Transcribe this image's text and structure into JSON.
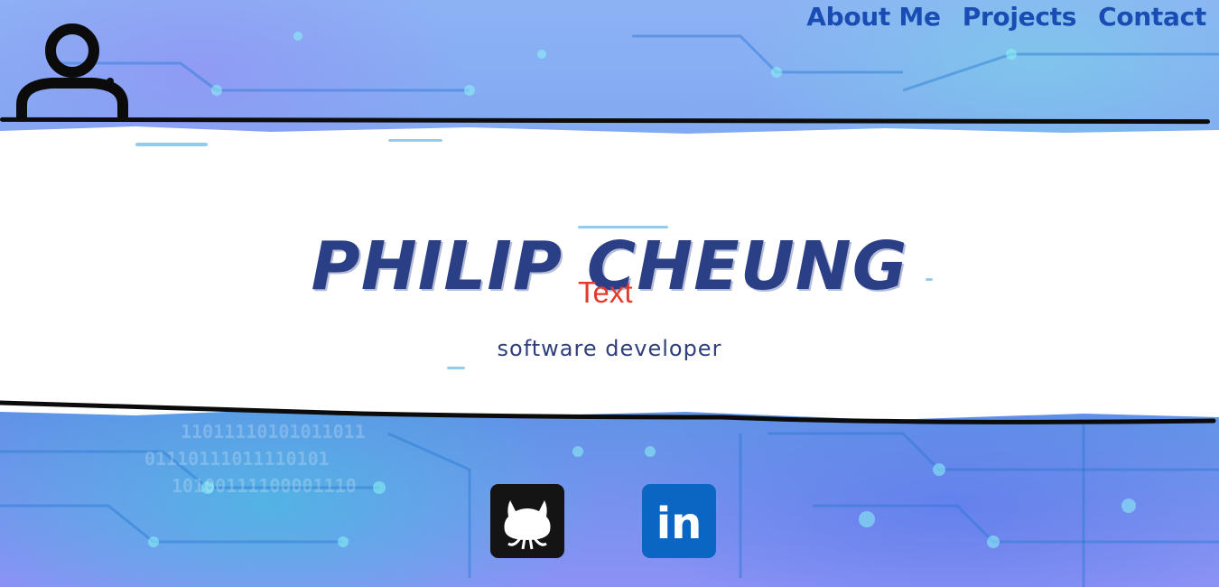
{
  "nav": {
    "items": [
      {
        "label": "About Me"
      },
      {
        "label": "Projects"
      },
      {
        "label": "Contact"
      }
    ]
  },
  "hero": {
    "name": "PHILIP CHEUNG",
    "overlay_text": "Text",
    "subtitle": "software developer"
  },
  "social": [
    {
      "icon": "github-icon"
    },
    {
      "icon": "linkedin-icon",
      "label": "in"
    }
  ],
  "colors": {
    "nav_text": "#1a4db3",
    "name_text": "#2b3f86",
    "overlay_text": "#e23b2c",
    "github_bg": "#141414",
    "linkedin_bg": "#0a66c2"
  }
}
